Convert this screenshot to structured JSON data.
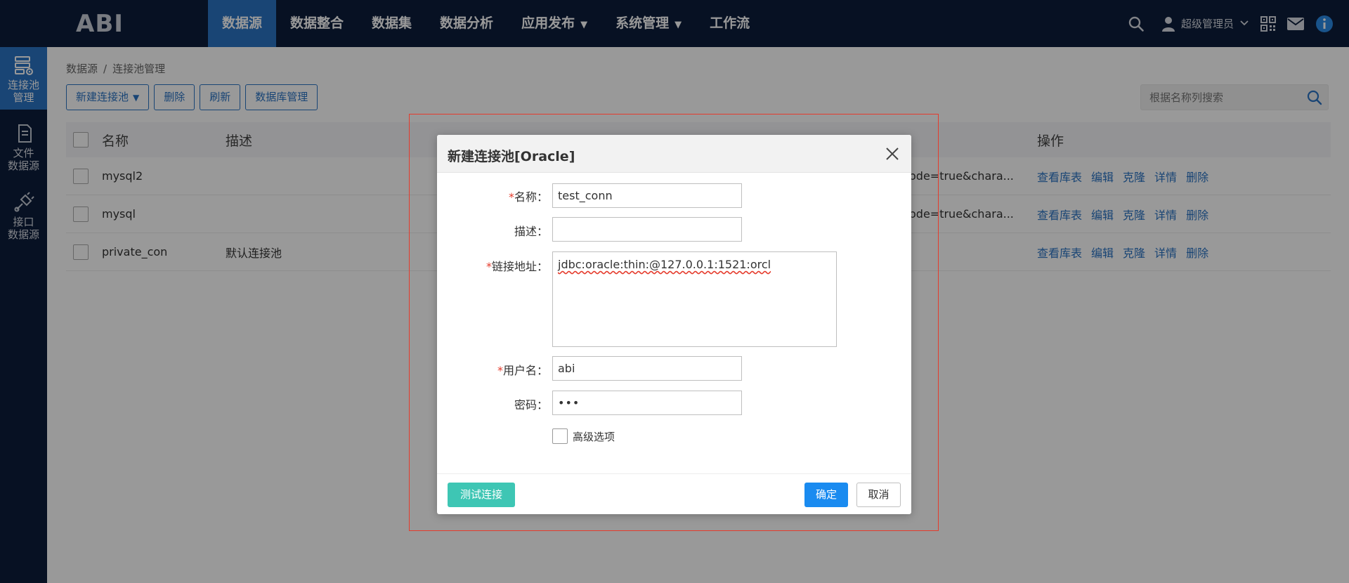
{
  "app": {
    "logo": "ABI"
  },
  "nav": {
    "items": [
      {
        "label": "数据源",
        "active": true,
        "dropdown": false
      },
      {
        "label": "数据整合",
        "active": false,
        "dropdown": false
      },
      {
        "label": "数据集",
        "active": false,
        "dropdown": false
      },
      {
        "label": "数据分析",
        "active": false,
        "dropdown": false
      },
      {
        "label": "应用发布",
        "active": false,
        "dropdown": true
      },
      {
        "label": "系统管理",
        "active": false,
        "dropdown": true
      },
      {
        "label": "工作流",
        "active": false,
        "dropdown": false
      }
    ],
    "caret": "▼"
  },
  "topright": {
    "user_name": "超级管理员",
    "icons": [
      "search-icon",
      "user-icon",
      "qrcode-icon",
      "mail-icon",
      "info-icon"
    ]
  },
  "sidebar": {
    "items": [
      {
        "label_line1": "连接池",
        "label_line2": "管理",
        "icon": "connection-pool-icon",
        "active": true
      },
      {
        "label_line1": "文件",
        "label_line2": "数据源",
        "icon": "file-icon",
        "active": false
      },
      {
        "label_line1": "接口",
        "label_line2": "数据源",
        "icon": "plug-icon",
        "active": false
      }
    ]
  },
  "breadcrumb": {
    "root": "数据源",
    "sep": "/",
    "current": "连接池管理"
  },
  "toolbar": {
    "new_pool": "新建连接池",
    "caret": "▼",
    "delete": "删除",
    "refresh": "刷新",
    "db_manage": "数据库管理"
  },
  "search": {
    "placeholder": "根据名称列搜索"
  },
  "table": {
    "headers": {
      "name": "名称",
      "desc": "描述",
      "ops": "操作"
    },
    "rows": [
      {
        "name": "mysql2",
        "desc": "",
        "url": "ode=true&chara..."
      },
      {
        "name": "mysql",
        "desc": "",
        "url": "ode=true&chara..."
      },
      {
        "name": "private_con",
        "desc": "默认连接池",
        "url": ""
      }
    ],
    "ops": [
      "查看库表",
      "编辑",
      "克隆",
      "详情",
      "删除"
    ]
  },
  "modal": {
    "title": "新建连接池[Oracle]",
    "required_mark": "*",
    "fields": {
      "name": {
        "label": "名称：",
        "value": "test_conn"
      },
      "desc": {
        "label": "描述：",
        "value": ""
      },
      "url": {
        "label": "链接地址：",
        "value": "jdbc:oracle:thin:@127.0.0.1:1521:orcl"
      },
      "user": {
        "label": "用户名：",
        "value": "abi"
      },
      "password": {
        "label": "密码：",
        "value": "•••"
      }
    },
    "advanced": "高级选项",
    "buttons": {
      "test": "测试连接",
      "ok": "确定",
      "cancel": "取消"
    }
  },
  "colors": {
    "nav_bg": "#0c1d3b",
    "accent": "#2b73c4",
    "test_btn": "#3ec6b4",
    "ok_btn": "#1a8bf0",
    "highlight_box": "#e53b2c"
  }
}
